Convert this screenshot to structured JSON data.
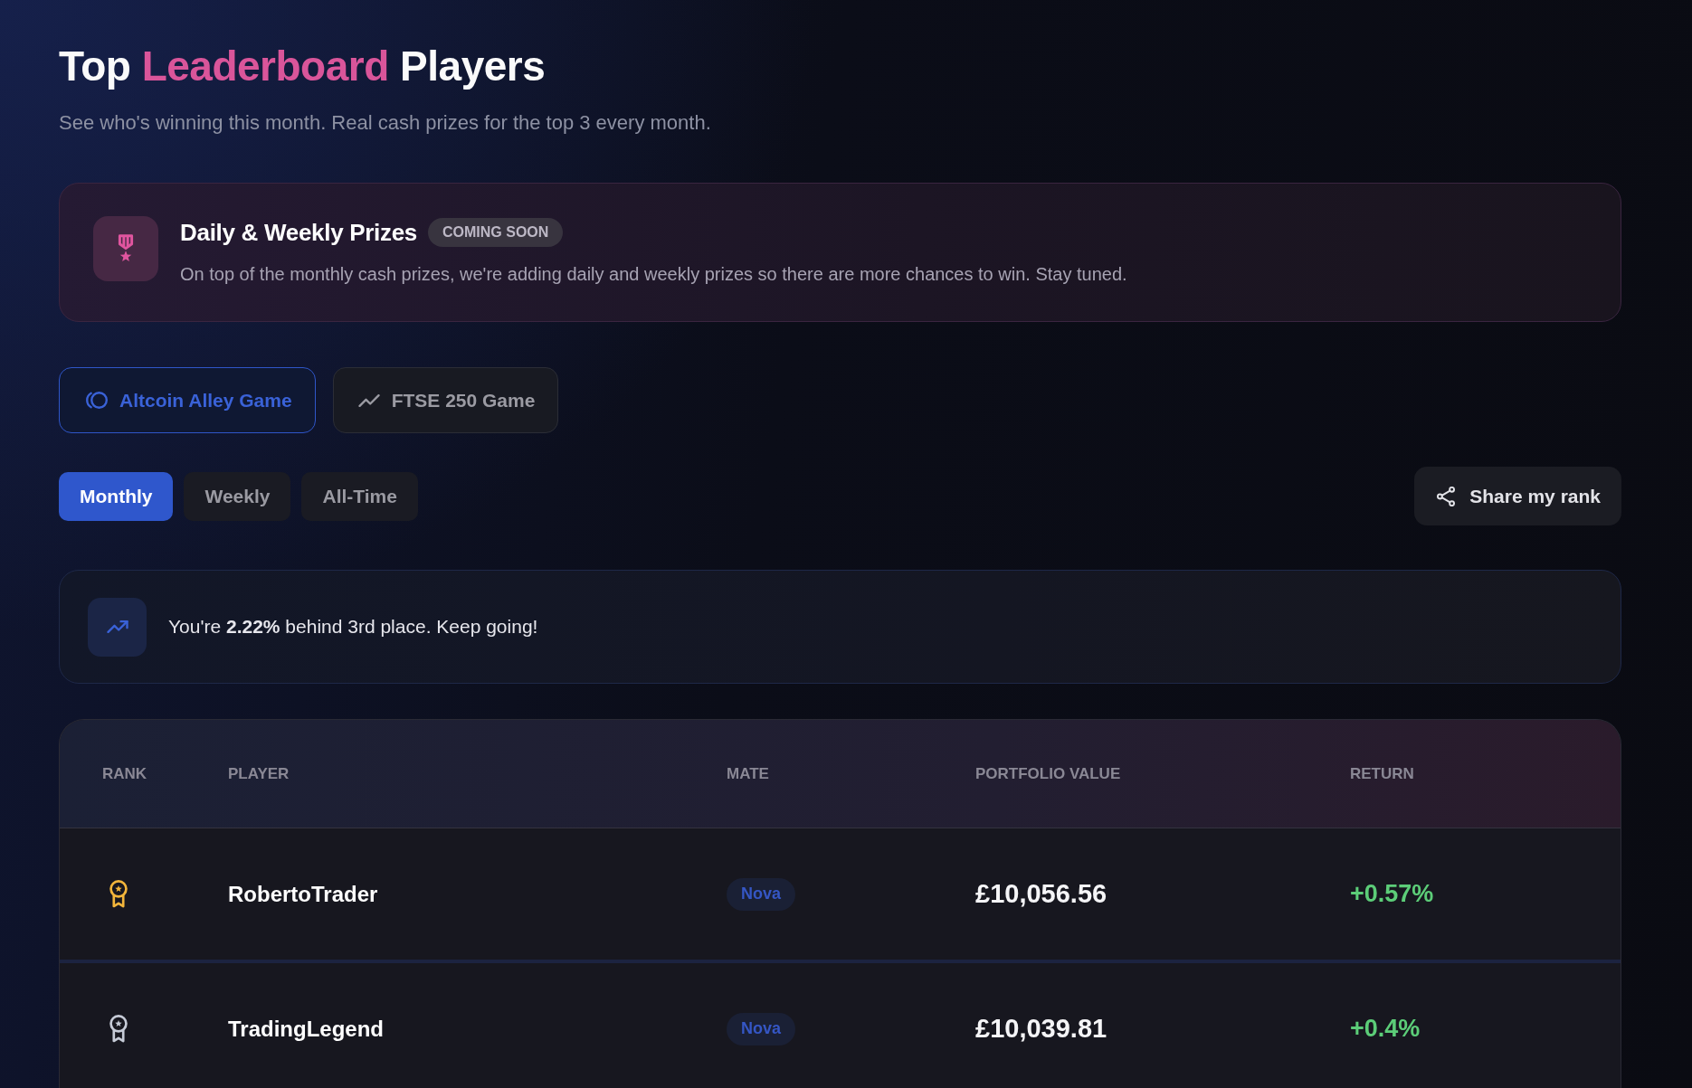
{
  "header": {
    "title": [
      {
        "text": "Top",
        "highlight": false
      },
      {
        "text": "Leaderboard",
        "highlight": true
      },
      {
        "text": "Players",
        "highlight": false
      }
    ],
    "subtitle": "See who's winning this month. Real cash prizes for the top 3 every month."
  },
  "prize_banner": {
    "title": "Daily & Weekly Prizes",
    "badge": "COMING SOON",
    "description": "On top of the monthly cash prizes, we're adding daily and weekly prizes so there are more chances to win. Stay tuned."
  },
  "game_tabs": [
    {
      "kind": "crypto",
      "label": "Altcoin Alley Game",
      "selected": true
    },
    {
      "kind": "stocks",
      "label": "FTSE 250 Game",
      "selected": false
    }
  ],
  "period_tabs": [
    {
      "label": "Monthly",
      "selected": true
    },
    {
      "label": "Weekly",
      "selected": false
    },
    {
      "label": "All-Time",
      "selected": false
    }
  ],
  "share_button": {
    "label": "Share my rank"
  },
  "rank_notice": {
    "text": "You're **2.22%** behind 3rd place. Keep going!"
  },
  "table": {
    "columns": [
      "RANK",
      "PLAYER",
      "MATE",
      "PORTFOLIO VALUE",
      "RETURN"
    ],
    "rows": [
      {
        "color": "#f2b53b",
        "player": "RobertoTrader",
        "mate": "Nova",
        "portfolio_value": "£10,056.56",
        "return": "+0.57%"
      },
      {
        "color": "#c6cbd7",
        "player": "TradingLegend",
        "mate": "Nova",
        "portfolio_value": "£10,039.81",
        "return": "+0.4%"
      }
    ]
  }
}
